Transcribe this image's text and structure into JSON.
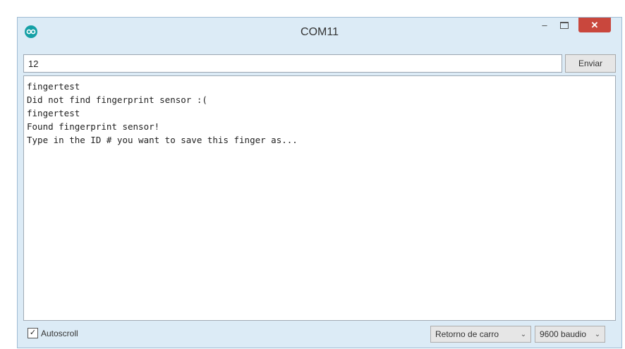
{
  "window": {
    "title": "COM11",
    "minimize_glyph": "–",
    "close_glyph": "✕",
    "app_icon": "arduino-infinity-icon"
  },
  "send": {
    "input_value": "12",
    "button_label": "Enviar"
  },
  "output": {
    "lines": [
      "fingertest",
      "Did not find fingerprint sensor :(",
      "fingertest",
      "Found fingerprint sensor!",
      "Type in the ID # you want to save this finger as..."
    ]
  },
  "statusbar": {
    "autoscroll_label": "Autoscroll",
    "autoscroll_checked": true,
    "check_glyph": "✓",
    "line_ending": "Retorno de carro",
    "baud_rate": "9600 baudio",
    "dropdown_glyph": "⌄"
  },
  "colors": {
    "window_bg": "#dcebf6",
    "close_button": "#c9473d",
    "app_icon": "#15a0a6"
  }
}
